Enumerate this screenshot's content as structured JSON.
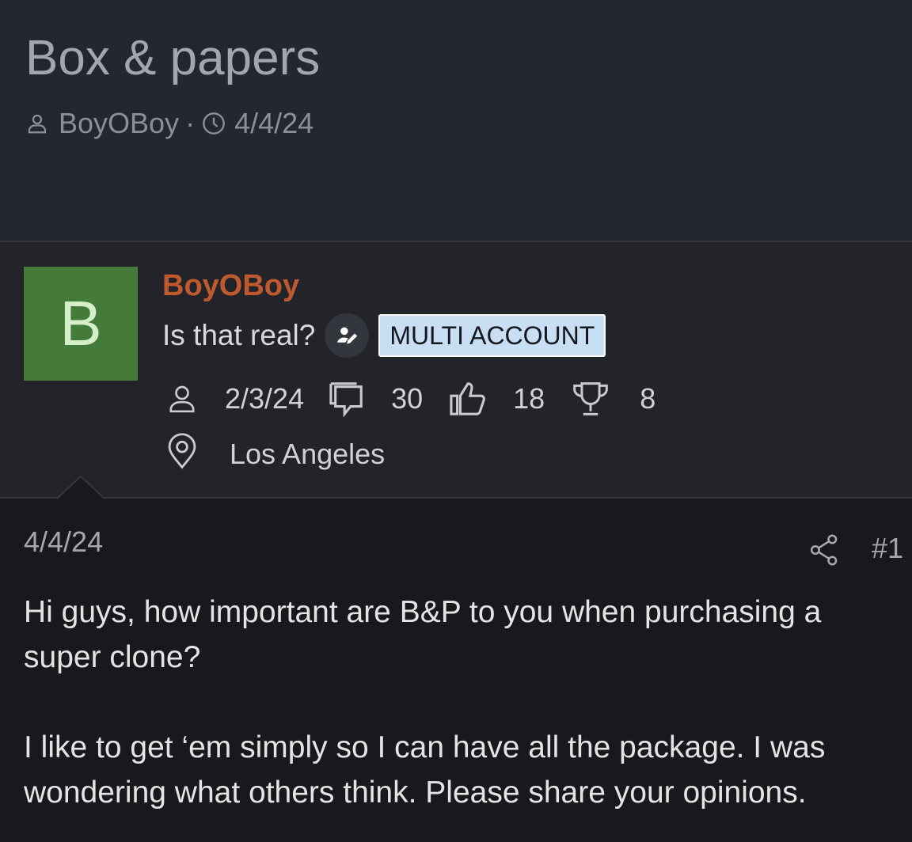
{
  "thread": {
    "title": "Box & papers",
    "author": "BoyOBoy",
    "separator": "·",
    "date": "4/4/24",
    "icons": [
      "user-outline-icon",
      "clock-icon"
    ]
  },
  "user": {
    "avatar_letter": "B",
    "name": "BoyOBoy",
    "title": "Is that real?",
    "badge": "MULTI ACCOUNT",
    "joined": "2/3/24",
    "messages": "30",
    "reactions": "18",
    "points": "8",
    "location": "Los Angeles",
    "icons": [
      "user-outline-icon",
      "speech-bubble-icon",
      "thumbs-up-icon",
      "trophy-icon",
      "location-pin-icon",
      "edit-user-icon"
    ]
  },
  "post": {
    "date": "4/4/24",
    "number": "#1",
    "paragraphs": [
      "Hi guys, how important are B&P to you when purchasing a super clone?",
      "I like to get ‘em simply so I can have all the package. I was wondering what others think. Please share your opinions."
    ],
    "icons": [
      "share-icon"
    ]
  },
  "colors": {
    "header_bg": "#24272f",
    "user_block_bg": "#222429",
    "post_bg": "#18191c",
    "username": "#c05a2e",
    "avatar_bg": "#447a3a",
    "badge_bg": "#c7def3"
  }
}
